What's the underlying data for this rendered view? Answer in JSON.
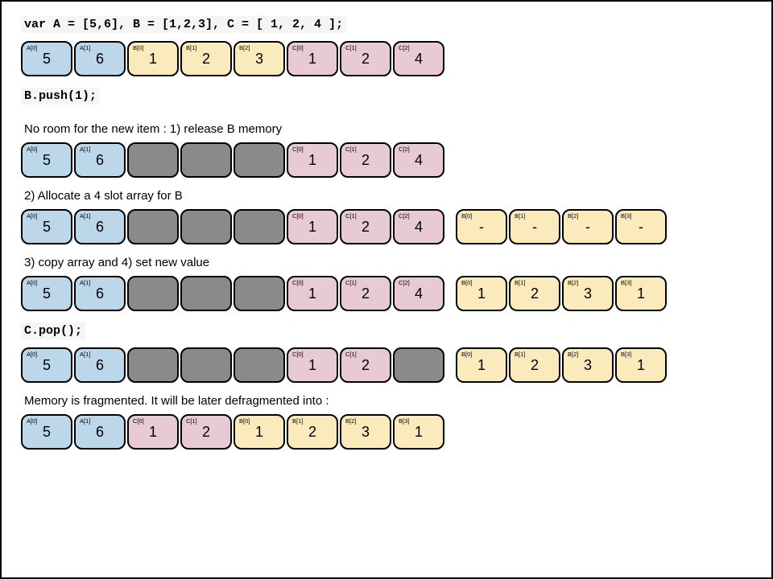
{
  "code1": "var A = [5,6],  B = [1,2,3], C = [ 1, 2, 4 ];",
  "code2": "B.push(1);",
  "code3": "C.pop();",
  "cap1": "No room for the new item : 1) release B memory",
  "cap2": "2) Allocate a 4 slot array for B",
  "cap3": "3) copy array and 4) set new value",
  "cap4": "Memory is fragmented. It will be later defragmented into :",
  "rows": {
    "r1": [
      {
        "cls": "a",
        "lbl": "A[0]",
        "val": "5"
      },
      {
        "cls": "a",
        "lbl": "A[1]",
        "val": "6"
      },
      {
        "cls": "b",
        "lbl": "B[0]",
        "val": "1"
      },
      {
        "cls": "b",
        "lbl": "B[1]",
        "val": "2"
      },
      {
        "cls": "b",
        "lbl": "B[2]",
        "val": "3"
      },
      {
        "cls": "c",
        "lbl": "C[0]",
        "val": "1"
      },
      {
        "cls": "c",
        "lbl": "C[1]",
        "val": "2"
      },
      {
        "cls": "c",
        "lbl": "C[2]",
        "val": "4"
      }
    ],
    "r2": [
      {
        "cls": "a",
        "lbl": "A[0]",
        "val": "5"
      },
      {
        "cls": "a",
        "lbl": "A[1]",
        "val": "6"
      },
      {
        "cls": "g",
        "lbl": "",
        "val": ""
      },
      {
        "cls": "g",
        "lbl": "",
        "val": ""
      },
      {
        "cls": "g",
        "lbl": "",
        "val": ""
      },
      {
        "cls": "c",
        "lbl": "C[0]",
        "val": "1"
      },
      {
        "cls": "c",
        "lbl": "C[1]",
        "val": "2"
      },
      {
        "cls": "c",
        "lbl": "C[2]",
        "val": "4"
      }
    ],
    "r3": [
      {
        "cls": "a",
        "lbl": "A[0]",
        "val": "5"
      },
      {
        "cls": "a",
        "lbl": "A[1]",
        "val": "6"
      },
      {
        "cls": "g",
        "lbl": "",
        "val": ""
      },
      {
        "cls": "g",
        "lbl": "",
        "val": ""
      },
      {
        "cls": "g",
        "lbl": "",
        "val": ""
      },
      {
        "cls": "c",
        "lbl": "C[0]",
        "val": "1"
      },
      {
        "cls": "c",
        "lbl": "C[1]",
        "val": "2"
      },
      {
        "cls": "c",
        "lbl": "C[2]",
        "val": "4"
      },
      {
        "cls": "sp"
      },
      {
        "cls": "b",
        "lbl": "B[0]",
        "val": "-"
      },
      {
        "cls": "b",
        "lbl": "B[1]",
        "val": "-"
      },
      {
        "cls": "b",
        "lbl": "B[2]",
        "val": "-"
      },
      {
        "cls": "b",
        "lbl": "B[3]",
        "val": "-"
      }
    ],
    "r4": [
      {
        "cls": "a",
        "lbl": "A[0]",
        "val": "5"
      },
      {
        "cls": "a",
        "lbl": "A[1]",
        "val": "6"
      },
      {
        "cls": "g",
        "lbl": "",
        "val": ""
      },
      {
        "cls": "g",
        "lbl": "",
        "val": ""
      },
      {
        "cls": "g",
        "lbl": "",
        "val": ""
      },
      {
        "cls": "c",
        "lbl": "C[0]",
        "val": "1"
      },
      {
        "cls": "c",
        "lbl": "C[1]",
        "val": "2"
      },
      {
        "cls": "c",
        "lbl": "C[2]",
        "val": "4"
      },
      {
        "cls": "sp"
      },
      {
        "cls": "b",
        "lbl": "B[0]",
        "val": "1"
      },
      {
        "cls": "b",
        "lbl": "B[1]",
        "val": "2"
      },
      {
        "cls": "b",
        "lbl": "B[2]",
        "val": "3"
      },
      {
        "cls": "b",
        "lbl": "B[3]",
        "val": "1"
      }
    ],
    "r5": [
      {
        "cls": "a",
        "lbl": "A[0]",
        "val": "5"
      },
      {
        "cls": "a",
        "lbl": "A[1]",
        "val": "6"
      },
      {
        "cls": "g",
        "lbl": "",
        "val": ""
      },
      {
        "cls": "g",
        "lbl": "",
        "val": ""
      },
      {
        "cls": "g",
        "lbl": "",
        "val": ""
      },
      {
        "cls": "c",
        "lbl": "C[0]",
        "val": "1"
      },
      {
        "cls": "c",
        "lbl": "C[1]",
        "val": "2"
      },
      {
        "cls": "g",
        "lbl": "",
        "val": ""
      },
      {
        "cls": "sp"
      },
      {
        "cls": "b",
        "lbl": "B[0]",
        "val": "1"
      },
      {
        "cls": "b",
        "lbl": "B[1]",
        "val": "2"
      },
      {
        "cls": "b",
        "lbl": "B[2]",
        "val": "3"
      },
      {
        "cls": "b",
        "lbl": "B[3]",
        "val": "1"
      }
    ],
    "r6": [
      {
        "cls": "a",
        "lbl": "A[0]",
        "val": "5"
      },
      {
        "cls": "a",
        "lbl": "A[1]",
        "val": "6"
      },
      {
        "cls": "c",
        "lbl": "C[0]",
        "val": "1"
      },
      {
        "cls": "c",
        "lbl": "C[1]",
        "val": "2"
      },
      {
        "cls": "b",
        "lbl": "B[0]",
        "val": "1"
      },
      {
        "cls": "b",
        "lbl": "B[1]",
        "val": "2"
      },
      {
        "cls": "b",
        "lbl": "B[2]",
        "val": "3"
      },
      {
        "cls": "b",
        "lbl": "B[3]",
        "val": "1"
      }
    ]
  }
}
